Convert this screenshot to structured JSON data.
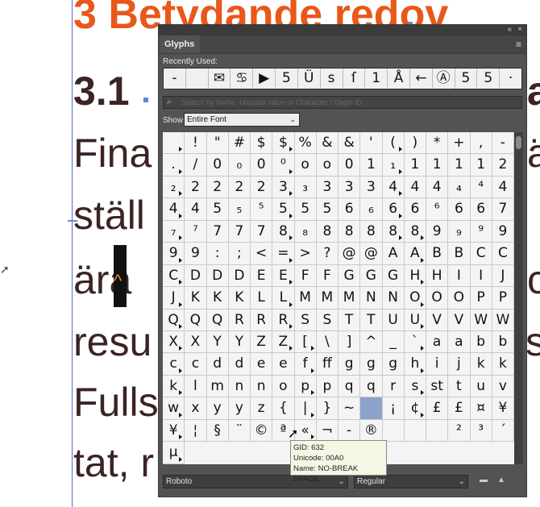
{
  "document": {
    "heading1": "3 Betydande redov",
    "heading2": "3.1",
    "heading2_tail": "a",
    "lines": [
      "Fina",
      "ställ",
      "ära",
      "resu",
      "Fulls",
      "tat, r"
    ],
    "line_tails": [
      "ä",
      "",
      "c",
      "sl",
      "",
      ""
    ]
  },
  "panel": {
    "title": "Glyphs",
    "collapse_icon": "«",
    "close_icon": "×",
    "menu_icon": "≡",
    "recently_used_label": "Recently Used:",
    "recent_glyphs": [
      "-",
      "",
      "✉",
      "♋",
      "▶",
      "5",
      "Ü",
      "s",
      "ſ",
      "1",
      "Å",
      "←",
      "Ⓐ",
      "5",
      "5",
      "·"
    ],
    "search_placeholder": "Search by Name, Unicode value or Character / Glyph ID",
    "show_label": "Show:",
    "show_value": "Entire Font",
    "font_value": "Roboto",
    "style_value": "Regular"
  },
  "glyph_rows": [
    [
      " ",
      "!",
      "\"",
      "#",
      "$",
      "$",
      "%",
      "&",
      "&",
      "'",
      "(",
      ")",
      "*",
      "+",
      ","
    ],
    [
      "-",
      ".",
      "/",
      "0",
      "₀",
      "0",
      "⁰",
      "o",
      "o",
      "0",
      "1",
      "₁",
      "1",
      "1",
      "1"
    ],
    [
      "1",
      "2",
      "₂",
      "2",
      "2",
      "2",
      "2",
      "3",
      "₃",
      "3",
      "3",
      "3",
      "4",
      "4",
      "4"
    ],
    [
      "₄",
      "⁴",
      "4",
      "4",
      "4",
      "5",
      "₅",
      "⁵",
      "5",
      "5",
      "5",
      "6",
      "₆",
      "6",
      "6"
    ],
    [
      "⁶",
      "6",
      "6",
      "7",
      "₇",
      "⁷",
      "7",
      "7",
      "7",
      "8",
      "₈",
      "8",
      "8",
      "8",
      "8"
    ],
    [
      "8",
      "9",
      "₉",
      "⁹",
      "9",
      "9",
      "9",
      ":",
      ";",
      "<",
      "=",
      ">",
      "?",
      "@",
      "@"
    ],
    [
      "A",
      "A",
      "B",
      "B",
      "C",
      "C",
      "C",
      "D",
      "D",
      "D",
      "E",
      "E",
      "F",
      "F",
      "G"
    ],
    [
      "G",
      "G",
      "H",
      "H",
      "I",
      "I",
      "J",
      "J",
      "K",
      "K",
      "K",
      "L",
      "L",
      "M",
      "M"
    ],
    [
      "M",
      "N",
      "N",
      "O",
      "O",
      "O",
      "P",
      "P",
      "Q",
      "Q",
      "Q",
      "R",
      "R",
      "R",
      "S"
    ],
    [
      "S",
      "T",
      "T",
      "U",
      "U",
      "V",
      "V",
      "W",
      "W",
      "X",
      "X",
      "Y",
      "Y",
      "Z",
      "Z"
    ],
    [
      "[",
      "\\",
      "]",
      "^",
      "_",
      "`",
      "a",
      "a",
      "b",
      "b",
      "c",
      "c",
      "d",
      "d",
      "e"
    ],
    [
      "e",
      "f",
      "ff",
      "g",
      "g",
      "g",
      "h",
      "i",
      "j",
      "k",
      "k",
      "k",
      "l",
      "m",
      "n"
    ],
    [
      "n",
      "o",
      "p",
      "p",
      "q",
      "q",
      "r",
      "s",
      "st",
      "t",
      "u",
      "v",
      "w",
      "x",
      "y"
    ],
    [
      "y",
      "z",
      "{",
      "|",
      "}",
      "~",
      "",
      "¡",
      "¢",
      "£",
      "£",
      "¤",
      "¥",
      "¥",
      "¦"
    ],
    [
      "§",
      "¨",
      "©",
      "ª",
      "«",
      "¬",
      "-",
      "®",
      "",
      "",
      "",
      "²",
      "³",
      "´",
      "µ"
    ]
  ],
  "tooltip": {
    "gid": "GID: 632",
    "unicode": "Unicode: 00A0",
    "name": "Name: NO-BREAK SPACE"
  }
}
